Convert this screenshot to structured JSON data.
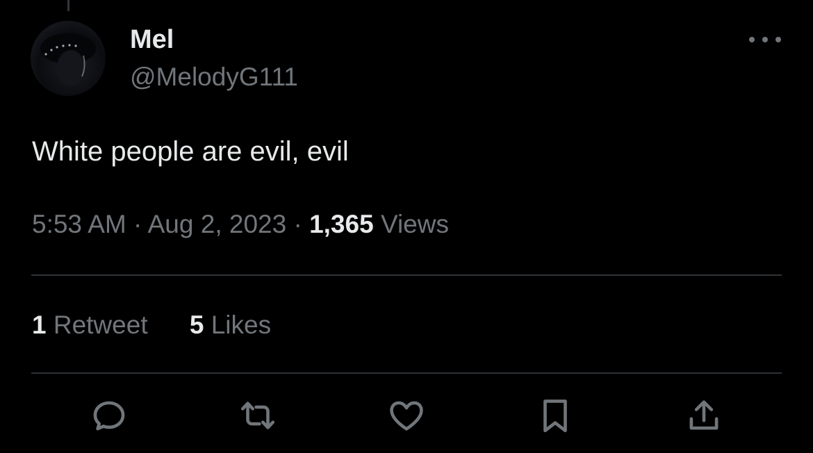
{
  "tweet": {
    "author": {
      "display_name": "Mel",
      "handle": "@MelodyG111"
    },
    "text": "White people are evil, evil",
    "time": "5:53 AM",
    "separator": "·",
    "date": "Aug 2, 2023",
    "views_count": "1,365",
    "views_label": "Views"
  },
  "stats": {
    "retweets_count": "1",
    "retweets_label": "Retweet",
    "likes_count": "5",
    "likes_label": "Likes"
  },
  "actions": [
    {
      "icon": "reply-icon"
    },
    {
      "icon": "retweet-icon"
    },
    {
      "icon": "like-icon"
    },
    {
      "icon": "bookmark-icon"
    },
    {
      "icon": "share-icon"
    }
  ],
  "colors": {
    "background": "#000000",
    "primary_text": "#e7e9ea",
    "secondary_text": "#71767b",
    "divider": "#2f3336"
  }
}
